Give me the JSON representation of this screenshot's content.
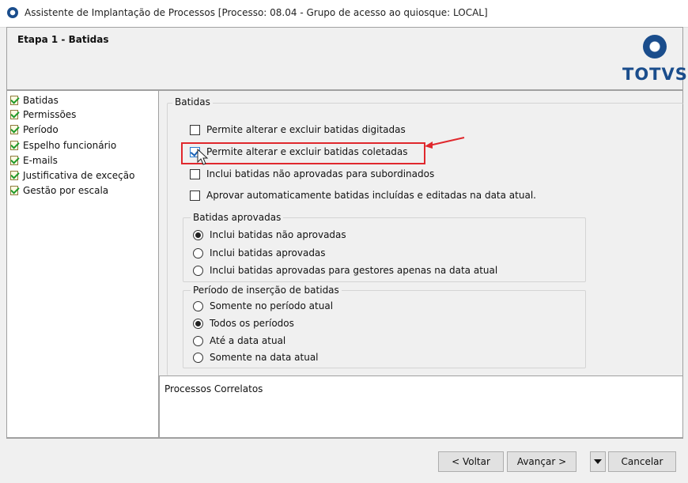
{
  "window": {
    "title": "Assistente de Implantação de Processos [Processo: 08.04 - Grupo de acesso ao quiosque: LOCAL]"
  },
  "header": {
    "step_title": "Etapa 1 - Batidas",
    "logo_text": "TOTVS"
  },
  "tree": {
    "items": [
      {
        "label": "Batidas"
      },
      {
        "label": "Permissões"
      },
      {
        "label": "Período"
      },
      {
        "label": "Espelho funcionário"
      },
      {
        "label": "E-mails"
      },
      {
        "label": "Justificativa de exceção"
      },
      {
        "label": "Gestão por escala"
      }
    ]
  },
  "batidas": {
    "group_label": "Batidas",
    "options": [
      {
        "label": "Permite alterar e excluir batidas digitadas",
        "checked": false
      },
      {
        "label": "Permite alterar e excluir batidas coletadas",
        "checked": true
      },
      {
        "label": "Inclui batidas não aprovadas para subordinados",
        "checked": false
      },
      {
        "label": "Aprovar automaticamente batidas incluídas e editadas na data atual.",
        "checked": false
      }
    ]
  },
  "batidas_aprovadas": {
    "group_label": "Batidas aprovadas",
    "options": [
      {
        "label": "Inclui batidas não aprovadas",
        "selected": true
      },
      {
        "label": "Inclui batidas aprovadas",
        "selected": false
      },
      {
        "label": "Inclui batidas aprovadas para gestores apenas na data atual",
        "selected": false
      }
    ]
  },
  "periodo_insercao": {
    "group_label": "Período de inserção de batidas",
    "options": [
      {
        "label": "Somente no período atual",
        "selected": false
      },
      {
        "label": "Todos os períodos",
        "selected": true
      },
      {
        "label": "Até a data atual",
        "selected": false
      },
      {
        "label": "Somente na data atual",
        "selected": false
      }
    ]
  },
  "related": {
    "label": "Processos Correlatos"
  },
  "footer": {
    "back_label": "< Voltar",
    "next_label": "Avançar >",
    "cancel_label": "Cancelar"
  },
  "colors": {
    "brand": "#1a4d8c",
    "highlight": "#e0282d"
  }
}
